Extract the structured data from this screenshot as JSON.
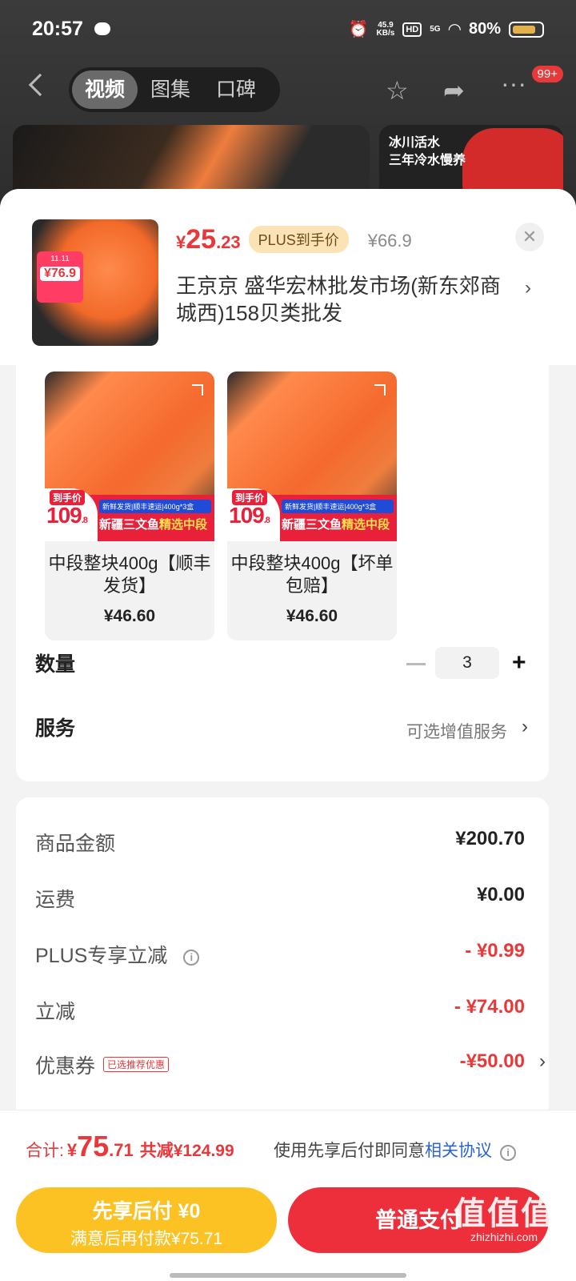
{
  "status_bar": {
    "time": "20:57",
    "net_speed_top": "45.9",
    "net_speed_unit": "KB/s",
    "hd": "HD",
    "network": "5G",
    "battery": "80%"
  },
  "nav": {
    "tabs": [
      "视频",
      "图集",
      "口碑"
    ],
    "active_tab": "视频",
    "badge": "99+"
  },
  "background_card": {
    "text_line1": "冰川活水",
    "text_line2": "三年冷水慢养"
  },
  "product": {
    "price_currency": "¥",
    "price_int": "25",
    "price_dec": ".23",
    "plus_label": "PLUS到手价",
    "original_price": "¥66.9",
    "shop_name": "王京京 盛华宏林批发市场(新东郊商城西)158贝类批发",
    "thumb_badge_price": "¥76.9"
  },
  "options": [
    {
      "name": "中段整块400g【顺丰发货】",
      "price": "¥46.60",
      "banner_label": "到手价",
      "banner_price": "109",
      "banner_price_sub": ".8",
      "banner_top": "新鲜发货|顺丰速运|400g*3盒",
      "banner_mid_a": "新疆三文鱼",
      "banner_mid_b": "精选中段"
    },
    {
      "name": "中段整块400g【坏单包赔】",
      "price": "¥46.60",
      "banner_label": "到手价",
      "banner_price": "109",
      "banner_price_sub": ".8",
      "banner_top": "新鲜发货|顺丰速运|400g*3盒",
      "banner_mid_a": "新疆三文鱼",
      "banner_mid_b": "精选中段"
    }
  ],
  "quantity": {
    "label": "数量",
    "value": "3",
    "minus": "−",
    "plus": "+"
  },
  "service": {
    "label": "服务",
    "value": "可选增值服务"
  },
  "summary": {
    "goods_amount": {
      "label": "商品金额",
      "value": "¥200.70"
    },
    "shipping": {
      "label": "运费",
      "value": "¥0.00"
    },
    "plus_discount": {
      "label": "PLUS专享立减",
      "value": "- ¥0.99"
    },
    "instant_discount": {
      "label": "立减",
      "value": "- ¥74.00"
    },
    "coupon": {
      "label": "优惠券",
      "tag": "已选推荐优惠",
      "value": "-¥50.00"
    }
  },
  "footer": {
    "total_label": "合计:",
    "total_currency": "¥",
    "total_int": "75",
    "total_dec": ".71",
    "total_saving": "共减¥124.99",
    "agreement_text": "使用先享后付即同意",
    "agreement_link": "相关协议",
    "btn_later_line1": "先享后付 ¥0",
    "btn_later_line2": "满意后再付款¥75.71",
    "btn_pay": "普通支付"
  },
  "watermark": {
    "big": "值值值",
    "small": "zhizhizhi.com"
  },
  "colors": {
    "accent_red": "#e8383a",
    "pay_red": "#ec2f3a",
    "later_yellow": "#fcc224",
    "link_blue": "#2962d9",
    "plus_gold_bg": "#fbe3b5"
  }
}
